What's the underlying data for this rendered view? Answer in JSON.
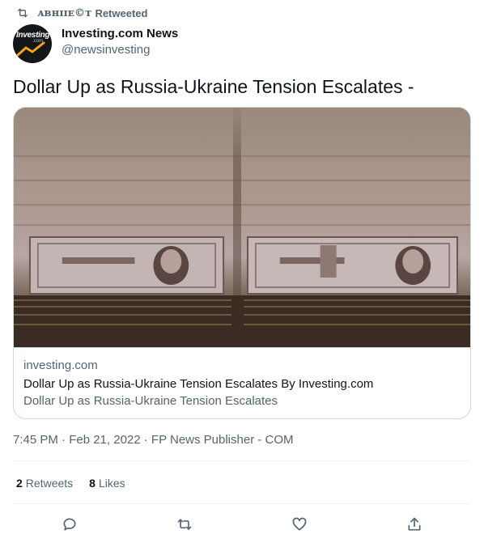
{
  "retweet_context": {
    "user": "ᴀʙʜɪɪᴇ©ᴛ",
    "label": "Retweeted",
    "icon": "retweet-icon"
  },
  "author": {
    "display_name": "Investing.com News",
    "handle": "@newsinvesting",
    "avatar_text": "Investing",
    "avatar_sub": ".com"
  },
  "tweet": {
    "text": "Dollar Up as Russia-Ukraine Tension Escalates -"
  },
  "card": {
    "domain": "investing.com",
    "title": "Dollar Up as Russia-Ukraine Tension Escalates By Investing.com",
    "description": "Dollar Up as Russia-Ukraine Tension Escalates"
  },
  "meta": {
    "timestamp": "7:45 PM · Feb 21, 2022 · FP News Publisher - COM"
  },
  "stats": {
    "retweets_count": "2",
    "retweets_label": "Retweets",
    "likes_count": "8",
    "likes_label": "Likes"
  },
  "actions": [
    "reply-icon",
    "retweet-icon",
    "like-icon",
    "share-icon"
  ],
  "colors": {
    "text_primary": "#0f1419",
    "text_secondary": "#536471",
    "border": "#cfd9de"
  }
}
